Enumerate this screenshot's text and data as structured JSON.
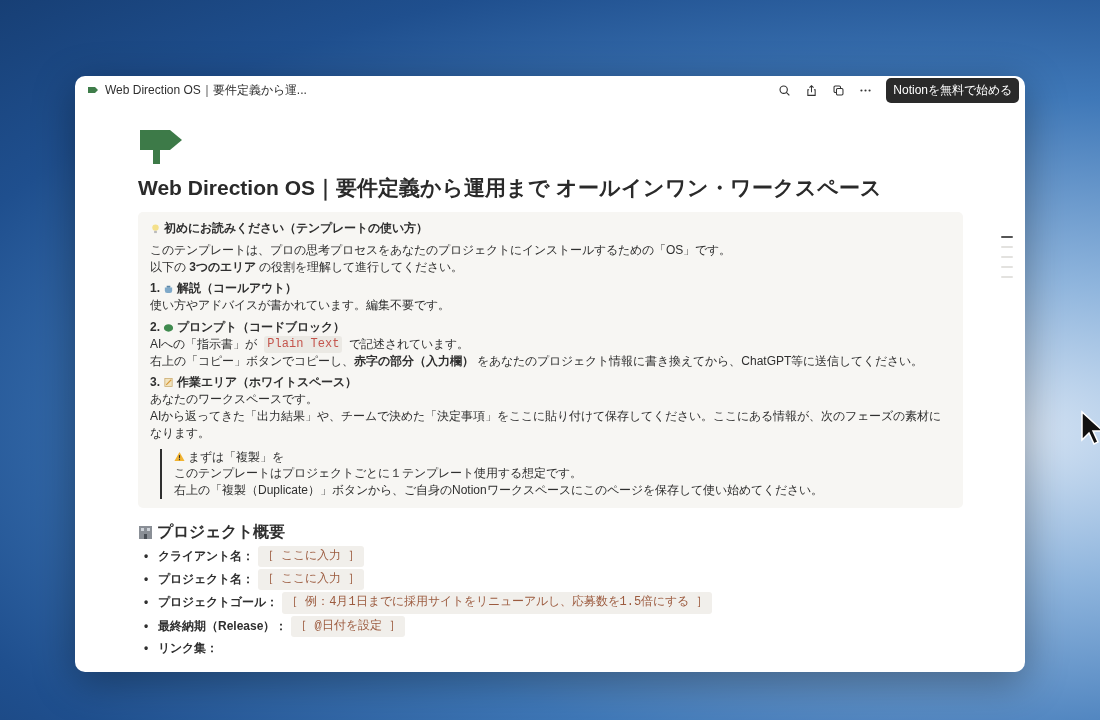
{
  "window": {
    "breadcrumb": "Web Direction OS｜要件定義から運...",
    "toolbar": [
      {
        "kind": "search"
      },
      {
        "kind": "share"
      },
      {
        "kind": "duplicate"
      },
      {
        "kind": "more"
      }
    ],
    "cta": "Notionを無料で始める"
  },
  "page": {
    "title": "Web Direction OS｜要件定義から運用まで オールインワン・ワークスペース",
    "callout": {
      "heading": "初めにお読みください（テンプレートの使い方）",
      "intro": [
        "このテンプレートは、プロの思考プロセスをあなたのプロジェクトにインストールするための「OS」です。",
        "以下の **3つのエリア** の役割を理解して進行してください。"
      ],
      "sections": [
        {
          "number": "1.",
          "kind": "pot",
          "title": "解説（コールアウト）",
          "lines": [
            {
              "before": "使い方やアドバイスが書かれています。編集不要です。"
            }
          ]
        },
        {
          "number": "2.",
          "kind": "blob",
          "title": "プロンプト（コードブロック）",
          "lines": [
            {
              "before": "AIへの「指示書」が",
              "code": "Plain Text",
              "after": "で記述されています。"
            },
            {
              "before": "右上の「コピー」ボタンでコピーし、**赤字の部分（入力欄）** をあなたのプロジェクト情報に書き換えてから、ChatGPT等に送信してください。"
            }
          ]
        },
        {
          "number": "3.",
          "kind": "memo",
          "title": "作業エリア（ホワイトスペース）",
          "lines": [
            {
              "before": "あなたのワークスペースです。"
            },
            {
              "before": "AIから返ってきた「出力結果」や、チームで決めた「決定事項」をここに貼り付けて保存してください。ここにある情報が、次のフェーズの素材になります。"
            }
          ]
        }
      ],
      "quote": {
        "heading": "まずは「複製」を",
        "lines": [
          "このテンプレートはプロジェクトごとに１テンプレート使用する想定です。",
          "右上の「複製（Duplicate）」ボタンから、ご自身のNotionワークスペースにこのページを保存して使い始めてください。"
        ]
      }
    },
    "section_heading": "プロジェクト概要",
    "items": [
      {
        "marker": "•",
        "label": "クライアント名：",
        "value": "［ ここに入力 ］"
      },
      {
        "marker": "•",
        "label": "プロジェクト名：",
        "value": "［ ここに入力 ］"
      },
      {
        "marker": "•",
        "label": "プロジェクトゴール：",
        "value": "［ 例：4月1日までに採用サイトをリニューアルし、応募数を1.5倍にする ］"
      },
      {
        "marker": "•",
        "label": "最終納期（Release）：",
        "value": "［ @日付を設定 ］"
      },
      {
        "marker": "•",
        "label": "リンク集："
      }
    ]
  },
  "outline": [
    {
      "selected": true
    },
    {
      "selected": false
    },
    {
      "selected": false
    },
    {
      "selected": false
    },
    {
      "selected": false
    }
  ]
}
